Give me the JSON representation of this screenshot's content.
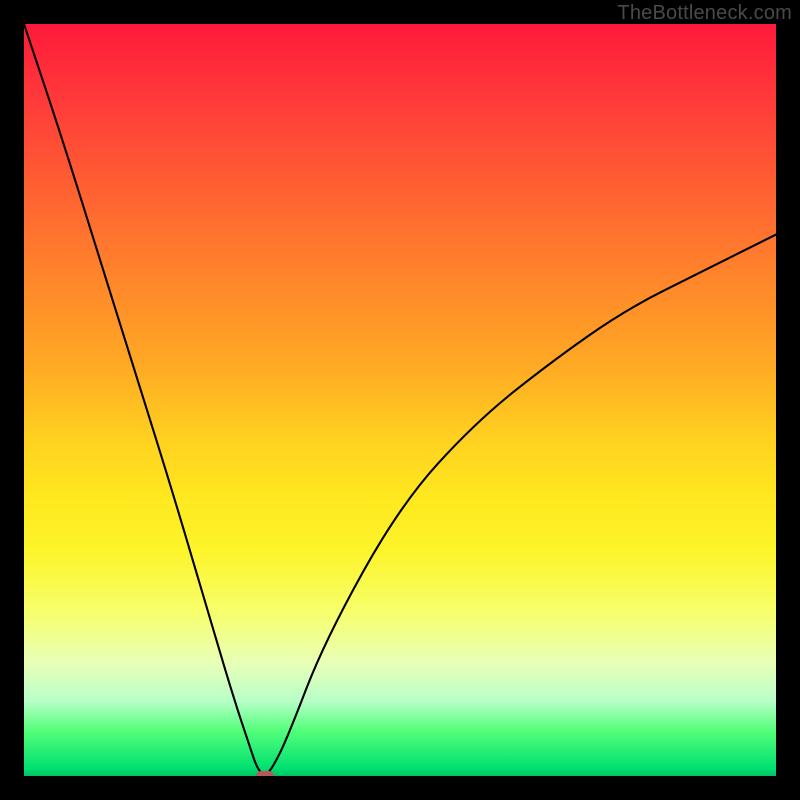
{
  "watermark": "TheBottleneck.com",
  "chart_data": {
    "type": "line",
    "title": "",
    "xlabel": "",
    "ylabel": "",
    "xlim": [
      0,
      100
    ],
    "ylim": [
      0,
      100
    ],
    "grid": false,
    "series": [
      {
        "name": "bottleneck-curve",
        "x": [
          0,
          5,
          10,
          15,
          20,
          25,
          28,
          30,
          31,
          32,
          33,
          35,
          40,
          50,
          60,
          70,
          80,
          90,
          100
        ],
        "values": [
          100,
          85,
          69,
          53,
          37,
          20,
          10,
          4,
          1,
          0,
          1,
          5,
          18,
          36,
          47,
          55,
          62,
          67,
          72
        ]
      }
    ],
    "markers": [
      {
        "name": "optimal-point",
        "x": 32,
        "y": 0,
        "color": "#b55a5a"
      }
    ],
    "background": {
      "type": "vertical-gradient",
      "stops": [
        {
          "pos": 0,
          "color": "#ff1a3a"
        },
        {
          "pos": 25,
          "color": "#ff6a30"
        },
        {
          "pos": 55,
          "color": "#ffd020"
        },
        {
          "pos": 78,
          "color": "#f7ff6a"
        },
        {
          "pos": 94,
          "color": "#53ff7a"
        },
        {
          "pos": 100,
          "color": "#00c060"
        }
      ]
    }
  }
}
